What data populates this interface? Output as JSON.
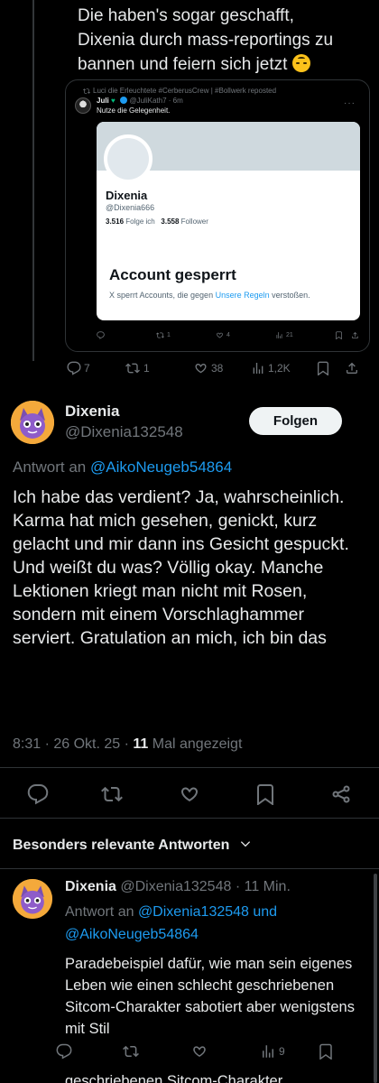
{
  "quoted_post": {
    "text": "Die haben's sogar geschafft, Dixenia durch mass-reportings zu bannen und feiern sich jetzt",
    "emoji_icon": "upside-down-face-emoji",
    "inner": {
      "repost_line": "Luci die Erleuchtete #CerberusCrew | #Bollwerk reposted",
      "author_name": "Juli",
      "author_handle": "@JuliKath7",
      "time": "· 6m",
      "text": "Nutze die Gelegenheit.",
      "suspended_card": {
        "name": "Dixenia",
        "handle": "@Dixenia666",
        "following_count": "3.516",
        "following_label": "Folge ich",
        "followers_count": "3.558",
        "followers_label": "Follower",
        "title": "Account gesperrt",
        "desc_prefix": "X sperrt Accounts, die gegen",
        "desc_link": "Unsere Regeln",
        "desc_suffix": "verstoßen."
      },
      "actions": {
        "replies": "",
        "reposts": "1",
        "likes": "4",
        "views": "21"
      }
    },
    "actions": {
      "replies": "7",
      "reposts": "1",
      "likes": "38",
      "views": "1,2K"
    }
  },
  "main_post": {
    "author_name": "Dixenia",
    "author_handle": "@Dixenia132548",
    "follow_label": "Folgen",
    "reply_prefix": "Antwort an",
    "reply_handle": "@AikoNeugeb54864",
    "body": "Ich habe das verdient? Ja, wahrscheinlich. Karma hat mich gesehen, genickt, kurz gelacht und mir dann ins Gesicht gespuckt. Und weißt du was? Völlig okay. Manche Lektionen kriegt man nicht mit Rosen, sondern mit einem Vorschlaghammer serviert. Gratulation an mich, ich bin das",
    "time": "8:31 · 26 Okt. 25 ·",
    "views_count": "11",
    "views_label": "Mal angezeigt"
  },
  "section_header": "Besonders relevante Antworten",
  "reply": {
    "author_name": "Dixenia",
    "author_handle": "@Dixenia132548",
    "time": "· 11 Min.",
    "reply_prefix": "Antwort an",
    "reply_handles": "@Dixenia132548 und @AikoNeugeb54864",
    "body": "Paradebeispiel dafür, wie man sein eigenes Leben wie einen schlecht geschriebenen Sitcom-Charakter sabotiert  aber wenigstens mit Stil",
    "views": "9",
    "cut_text": "geschriebenen Sitcom-Charakter"
  },
  "colors": {
    "background": "#000000",
    "text": "#e7e9ea",
    "muted": "#71767b",
    "link": "#1d9bf0",
    "border": "#2f3336"
  }
}
